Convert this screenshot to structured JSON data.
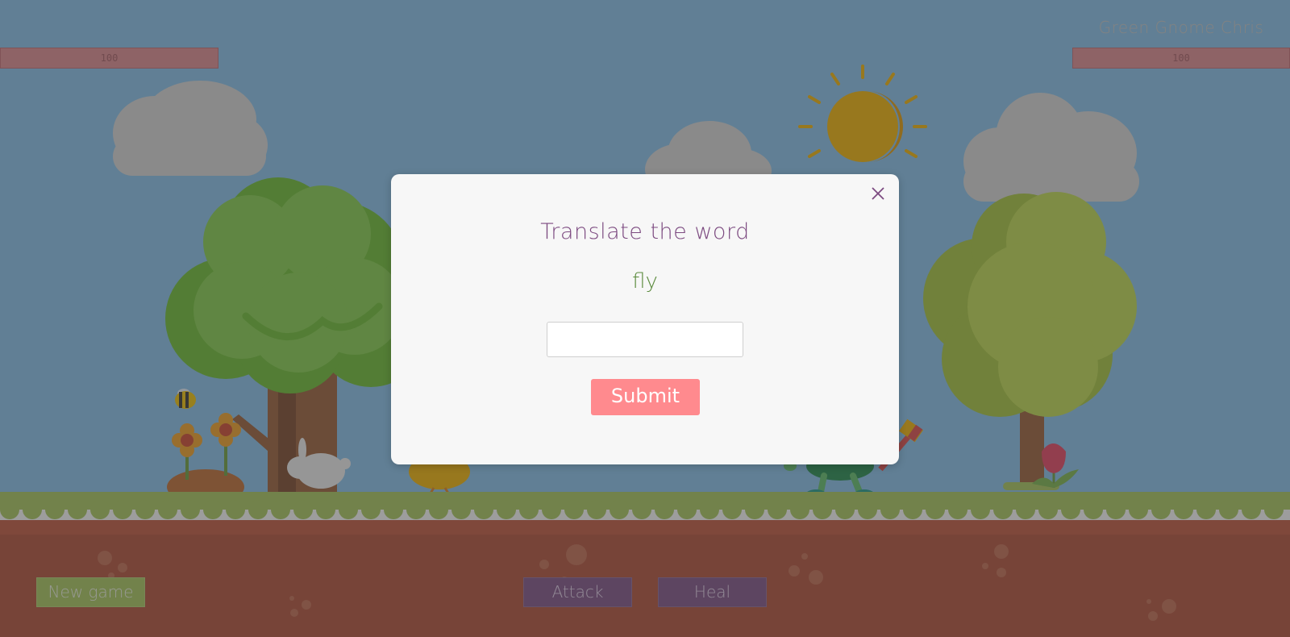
{
  "player": {
    "hp_label": "100",
    "hp": 100
  },
  "enemy": {
    "name": "Green Gnome Chris",
    "hp_label": "100",
    "hp": 100
  },
  "controls": {
    "new_game": "New game",
    "attack": "Attack",
    "heal": "Heal"
  },
  "modal": {
    "title": "Translate the word",
    "word": "fly",
    "input_value": "",
    "submit_label": "Submit",
    "close_icon": "close-icon"
  },
  "colors": {
    "sky": "#87c3ee",
    "grass": "#a8c95a",
    "dirt": "#b24c35",
    "hp_bar": "#e08a90",
    "button_purple": "#7e4e86",
    "button_green": "#a8c95a",
    "submit": "#ff8a8e",
    "title": "#7c4a80",
    "word": "#5a8a3c"
  }
}
